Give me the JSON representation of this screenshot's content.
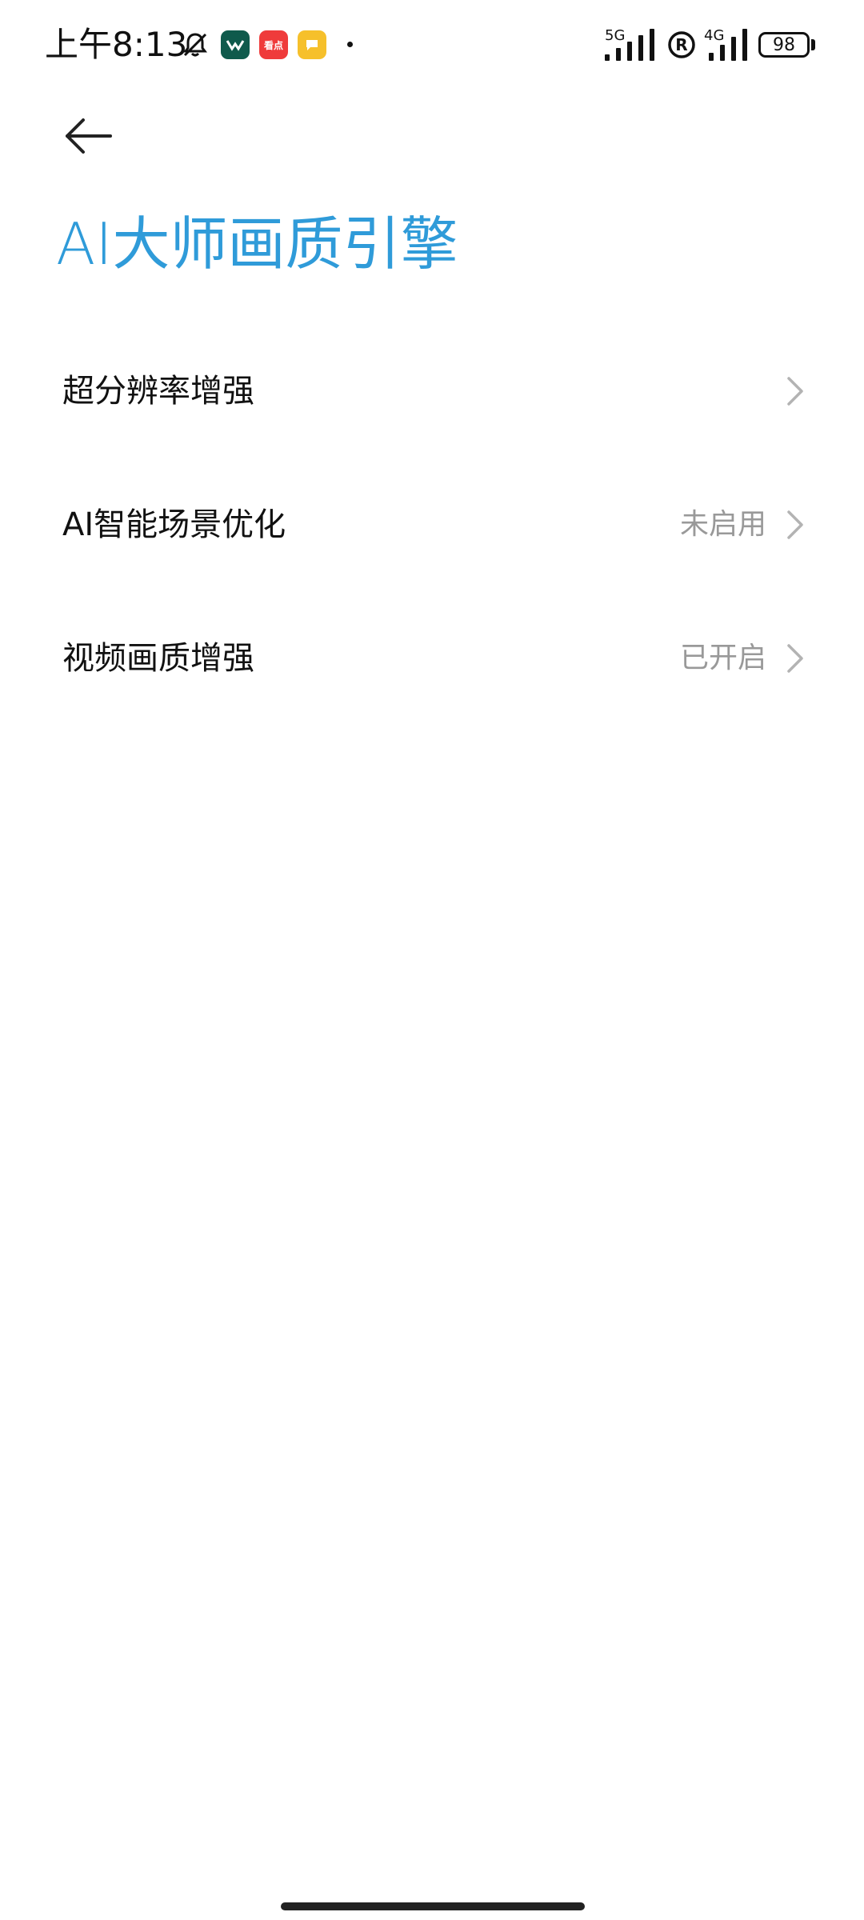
{
  "status_bar": {
    "time": "上午8:13",
    "app_icons": [
      "bell-off-icon",
      "green-app-icon",
      "red-app-icon",
      "yellow-message-icon"
    ],
    "red_app_text": "看点",
    "signal_1_label": "5G",
    "roaming_label": "R",
    "signal_2_label": "4G",
    "battery_level": "98"
  },
  "header": {
    "back_icon": "arrow-left-icon",
    "title": "AI大师画质引擎"
  },
  "settings": {
    "items": [
      {
        "label": "超分辨率增强",
        "value": ""
      },
      {
        "label": "AI智能场景优化",
        "value": "未启用"
      },
      {
        "label": "视频画质增强",
        "value": "已开启"
      }
    ]
  },
  "colors": {
    "title": "#2f9bd9",
    "value_text": "#999999",
    "chevron": "#b3b3b3"
  }
}
